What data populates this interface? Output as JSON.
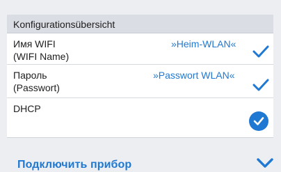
{
  "config_panel": {
    "title": "Konfigurationsübersicht",
    "rows": [
      {
        "label_line1": "Имя WIFI",
        "label_line2": "(WIFI Name)",
        "value": "»Heim-WLAN«",
        "status_icon": "checkmark-icon"
      },
      {
        "label_line1": "Пароль",
        "label_line2": "(Passwort)",
        "value": "»Passwort WLAN«",
        "status_icon": "checkmark-icon"
      },
      {
        "label_line1": "DHCP",
        "status_icon": "checkmark-circle-icon"
      }
    ]
  },
  "footer": {
    "label": "Подключить прибор",
    "icon": "chevron-down-icon"
  },
  "colors": {
    "accent": "#1f78d1",
    "background": "#eceef2",
    "header_background": "#dadde3",
    "text": "#1d1d1d"
  }
}
